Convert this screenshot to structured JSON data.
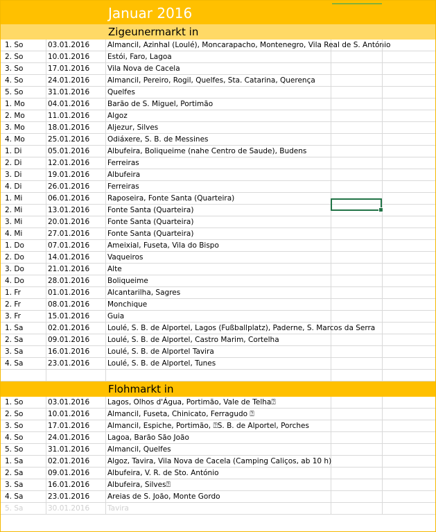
{
  "title": "Januar 2016",
  "sections": [
    {
      "heading": "Zigeunermarkt in",
      "rows": [
        [
          "1. So",
          "03.01.2016",
          "Almancil, Azinhal (Loulé), Moncarapacho, Montenegro, Vila Real de S. António"
        ],
        [
          "2. So",
          "10.01.2016",
          "Estói, Faro, Lagoa"
        ],
        [
          "3. So",
          "17.01.2016",
          "Vila Nova de Cacela"
        ],
        [
          "4. So",
          "24.01.2016",
          "Almancil, Pereiro, Rogil, Quelfes, Sta. Catarina, Querença"
        ],
        [
          "5. So",
          "31.01.2016",
          "Quelfes"
        ],
        [
          "1. Mo",
          "04.01.2016",
          " Barão de S. Miguel, Portimão"
        ],
        [
          "2. Mo",
          "11.01.2016",
          " Algoz"
        ],
        [
          "3. Mo",
          "18.01.2016",
          " Aljezur, Silves"
        ],
        [
          "4. Mo",
          "25.01.2016",
          " Odiáxere, S. B. de Messines"
        ],
        [
          "1. Di",
          "05.01.2016",
          "Albufeira, Boliqueime (nahe Centro de Saude), Budens"
        ],
        [
          "2. Di",
          "12.01.2016",
          "Ferreiras"
        ],
        [
          "3. Di",
          "19.01.2016",
          "Albufeira"
        ],
        [
          "4. Di",
          "26.01.2016",
          "Ferreiras"
        ],
        [
          "1. Mi",
          "06.01.2016",
          "Raposeira, Fonte Santa (Quarteira)"
        ],
        [
          "2. Mi",
          "13.01.2016",
          "Fonte Santa (Quarteira)"
        ],
        [
          "3. Mi",
          "20.01.2016",
          "Fonte Santa (Quarteira)"
        ],
        [
          "4. Mi",
          "27.01.2016",
          "Fonte Santa (Quarteira)"
        ],
        [
          "1. Do",
          "07.01.2016",
          "Ameixial, Fuseta, Vila do Bispo"
        ],
        [
          "2. Do",
          "14.01.2016",
          "Vaqueiros"
        ],
        [
          "3. Do",
          "21.01.2016",
          "Alte"
        ],
        [
          "4. Do",
          "28.01.2016",
          "Boliqueime"
        ],
        [
          "1. Fr",
          "01.01.2016",
          "Alcantarilha, Sagres"
        ],
        [
          "2. Fr",
          "08.01.2016",
          "Monchique"
        ],
        [
          "3. Fr",
          "15.01.2016",
          "Guia"
        ],
        [
          "1. Sa",
          "02.01.2016",
          "Loulé, S. B. de Alportel, Lagos (Fußballplatz), Paderne, S. Marcos da Serra"
        ],
        [
          "2. Sa",
          "09.01.2016",
          "Loulé, S. B. de Alportel, Castro Marim, Cortelha"
        ],
        [
          "3. Sa",
          "16.01.2016",
          "Loulé, S. B. de Alportel Tavira"
        ],
        [
          "4. Sa",
          "23.01.2016",
          "Loulé, S. B. de Alportel, Tunes"
        ]
      ]
    },
    {
      "heading": "Flohmarkt in",
      "rows": [
        [
          "1. So",
          "03.01.2016",
          "Lagos, Olhos d'Água, Portimão, Vale de Telha⍰"
        ],
        [
          "2. So",
          "10.01.2016",
          "Almancil, Fuseta, Chinicato, Ferragudo ⍰"
        ],
        [
          "3. So",
          "17.01.2016",
          "Almancil, Espiche, Portimão, ⍰S. B. de Alportel, Porches"
        ],
        [
          "4. So",
          "24.01.2016",
          "Lagoa, Barão São João"
        ],
        [
          "5. So",
          "31.01.2016",
          "Almancil, Quelfes"
        ],
        [
          "1. Sa",
          "02.01.2016",
          "Algoz, Tavira, Vila Nova de Cacela (Camping Caliços, ab 10 h)"
        ],
        [
          "2. Sa",
          "09.01.2016",
          "Albufeira, V. R. de Sto. António"
        ],
        [
          "3. Sa",
          "16.01.2016",
          "Albufeira, Silves⍰"
        ],
        [
          "4. Sa",
          "23.01.2016",
          "Areias de S. João, Monte Gordo"
        ],
        [
          "5. Sa",
          "30.01.2016",
          "Tavira"
        ]
      ]
    }
  ],
  "colors": {
    "title_band": "#FFC000",
    "section1_band": "#FFD966",
    "section2_band": "#FFC000",
    "selection": "#217346"
  }
}
